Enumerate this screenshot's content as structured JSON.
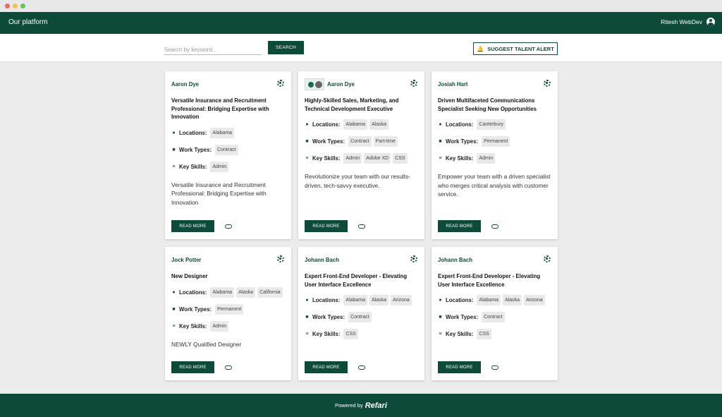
{
  "header": {
    "brand": "Our platform",
    "user": "Ritesh WebDev"
  },
  "search": {
    "placeholder": "Search by keyword..",
    "button": "SEARCH",
    "alert_button": "SUGGEST TALENT ALERT"
  },
  "labels": {
    "locations": "Locations:",
    "work_types": "Work Types:",
    "key_skills": "Key Skills:",
    "read_more": "READ MORE"
  },
  "cards": [
    {
      "name": "Aaron Dye",
      "title": "Versatile Insurance and Recruitment Professional: Bridging Expertise with Innovation",
      "locations": [
        "Alabama"
      ],
      "work_types": [
        "Contract"
      ],
      "skills": [
        "Admin"
      ],
      "summary": "Versatile Insurance and Recruitment Professional: Bridging Expertise with Innovation",
      "has_logo": false,
      "has_gear": true
    },
    {
      "name": "Aaron Dye",
      "title": "Highly-Skilled Sales, Marketing, and Technical Development Executive",
      "locations": [
        "Alabama",
        "Alaska"
      ],
      "work_types": [
        "Contract",
        "Part-time"
      ],
      "skills": [
        "Admin",
        "Adobe XD",
        "CSS"
      ],
      "summary": "Revolutionize your team with our results-driven, tech-savvy executive.",
      "has_logo": true,
      "has_gear": true
    },
    {
      "name": "Josiah Hart",
      "title": "Driven Multifaceted Communications Specialist Seeking New Opportunities",
      "locations": [
        "Canterbury"
      ],
      "work_types": [
        "Permanent"
      ],
      "skills": [
        "Admin"
      ],
      "summary": "Empower your team with a driven specialist who merges critical analysis with customer service.",
      "has_logo": false,
      "has_gear": true
    },
    {
      "name": "Jock Potter",
      "title": "New Designer",
      "locations": [
        "Alabama",
        "Alaska",
        "California"
      ],
      "work_types": [
        "Permanent"
      ],
      "skills": [
        "Admin"
      ],
      "summary": "NEWLY Qualified Designer",
      "has_logo": false,
      "has_gear": true
    },
    {
      "name": "Johann Bach",
      "title": "Expert Front-End Developer - Elevating User Interface Excellence",
      "locations": [
        "Alabama",
        "Alaska",
        "Arizona"
      ],
      "work_types": [
        "Contract"
      ],
      "skills": [
        "CSS"
      ],
      "summary": "",
      "has_logo": false,
      "has_gear": true
    },
    {
      "name": "Johann Bach",
      "title": "Expert Front-End Developer - Elevating User Interface Excellence",
      "locations": [
        "Alabama",
        "Alaska",
        "Arizona"
      ],
      "work_types": [
        "Contract"
      ],
      "skills": [
        "CSS"
      ],
      "summary": "",
      "has_logo": false,
      "has_gear": true
    }
  ],
  "footer": {
    "powered_by": "Powered by",
    "brand": "Refari"
  },
  "colors": {
    "primary": "#0e4a39",
    "background": "#ececec",
    "tag": "#e9e9e9"
  }
}
